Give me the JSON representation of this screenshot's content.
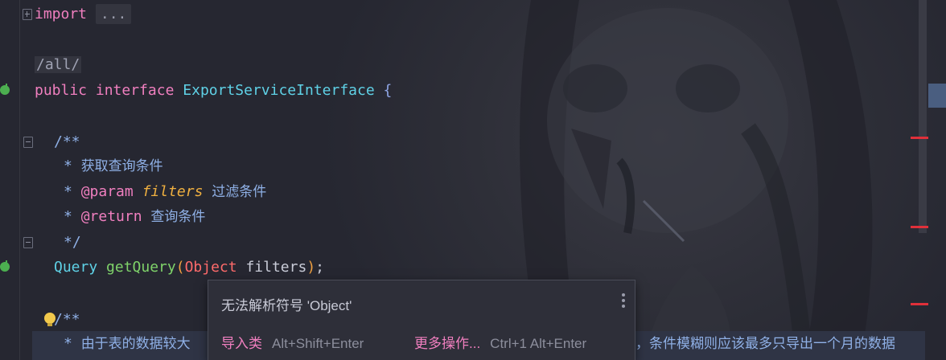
{
  "editor": {
    "lines": {
      "import_kw": "import",
      "import_dots": "...",
      "path_comment": "/all/",
      "iface_public": "public",
      "iface_interface": "interface",
      "iface_name": "ExportServiceInterface",
      "iface_brace": "{",
      "doc_open": "/**",
      "doc_star": "*",
      "doc_desc": "获取查询条件",
      "doc_param_tag": "@param",
      "doc_param_name": "filters",
      "doc_param_desc": "过滤条件",
      "doc_return_tag": "@return",
      "doc_return_desc": "查询条件",
      "doc_close": "*/",
      "method_type": "Query",
      "method_name": "getQuery",
      "method_paren_open": "(",
      "method_param_type": "Object",
      "method_param_name": "filters",
      "method_paren_close": ")",
      "method_semicolon": ";",
      "doc2_open": "/**",
      "doc2_text_left": "由于表的数据较大",
      "doc2_text_right": "，条件模糊则应该最多只导出一个月的数据"
    }
  },
  "popup": {
    "title": "无法解析符号 'Object'",
    "action_import_label": "导入类",
    "action_import_shortcut": "Alt+Shift+Enter",
    "action_more_label": "更多操作...",
    "action_more_shortcut": "Ctrl+1 Alt+Enter"
  },
  "colors": {
    "background": "#262731",
    "keyword": "#f07fbf",
    "type": "#5fd1e6",
    "method": "#7fd36a",
    "comment": "#8fb0e6",
    "error_marker": "#e0303a"
  },
  "icons": [
    "fold-plus-icon",
    "fold-minus-icon",
    "implementation-gutter-icon",
    "lightbulb-icon",
    "more-options-icon"
  ]
}
